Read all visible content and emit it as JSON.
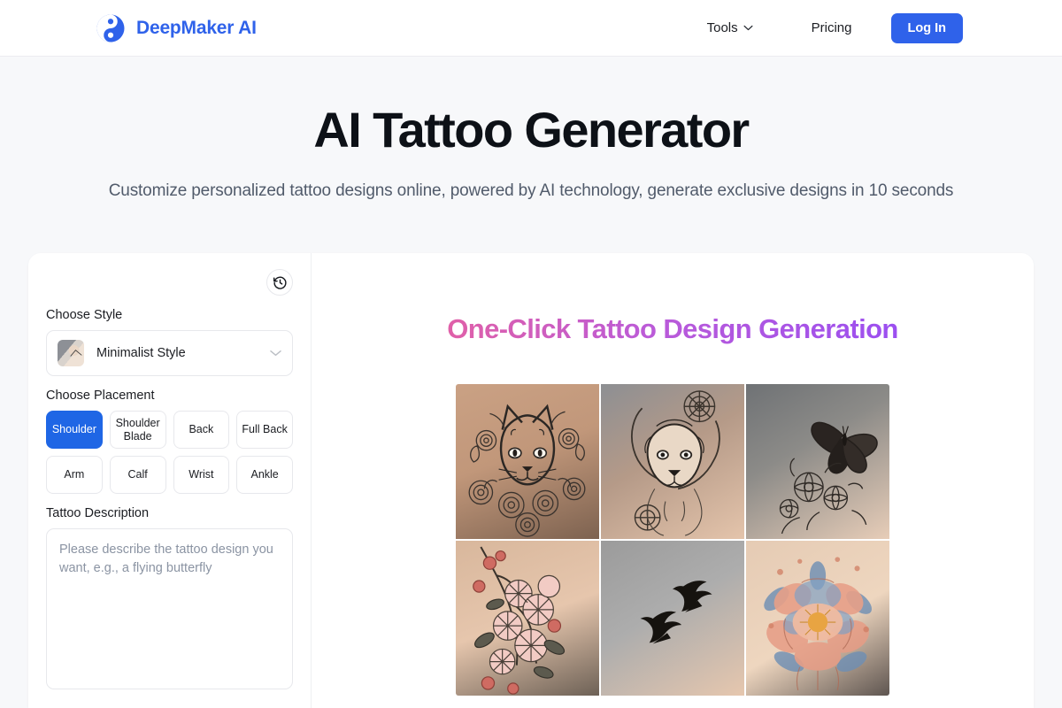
{
  "header": {
    "brand_name": "DeepMaker AI",
    "logo_icon": "yinyang-icon",
    "logo_color": "#2f62ea",
    "nav": [
      {
        "label": "Tools",
        "has_dropdown": true,
        "icon": "chevron-down-icon"
      },
      {
        "label": "Pricing",
        "has_dropdown": false
      }
    ],
    "login_label": "Log In",
    "login_color": "#2f62ea"
  },
  "hero": {
    "title": "AI Tattoo Generator",
    "subtitle": "Customize personalized tattoo designs online, powered by AI technology, generate exclusive designs in 10 seconds"
  },
  "panel": {
    "history_icon": "history-icon",
    "style": {
      "label": "Choose Style",
      "selected": "Minimalist Style",
      "thumbnail": "wrist-minimalist-tattoo-thumbnail",
      "chevron_icon": "chevron-down-icon"
    },
    "placement": {
      "label": "Choose Placement",
      "selected": "Shoulder",
      "selected_color": "#1f66e5",
      "options": [
        "Shoulder",
        "Shoulder Blade",
        "Back",
        "Full Back",
        "Arm",
        "Calf",
        "Wrist",
        "Ankle"
      ]
    },
    "description": {
      "label": "Tattoo Description",
      "value": "",
      "placeholder": "Please describe the tattoo design you want, e.g., a flying butterfly"
    }
  },
  "showcase": {
    "title": "One-Click Tattoo Design Generation",
    "title_gradient_from": "#e060a8",
    "title_gradient_to": "#9b4ff0",
    "gallery": [
      {
        "alt": "Cat face with roses tattoo on back",
        "name": "cat-roses-tattoo"
      },
      {
        "alt": "Lion head mandala tattoo on arm",
        "name": "lion-mandala-tattoo"
      },
      {
        "alt": "Butterfly and flowers tattoo on foot",
        "name": "butterfly-flowers-tattoo"
      },
      {
        "alt": "Cherry blossom branch tattoo on forearm",
        "name": "cherry-blossom-tattoo"
      },
      {
        "alt": "Two swallows tattoo on wrist",
        "name": "swallows-tattoo"
      },
      {
        "alt": "Watercolor peony flower tattoo on shoulder",
        "name": "watercolor-peony-tattoo"
      }
    ]
  }
}
